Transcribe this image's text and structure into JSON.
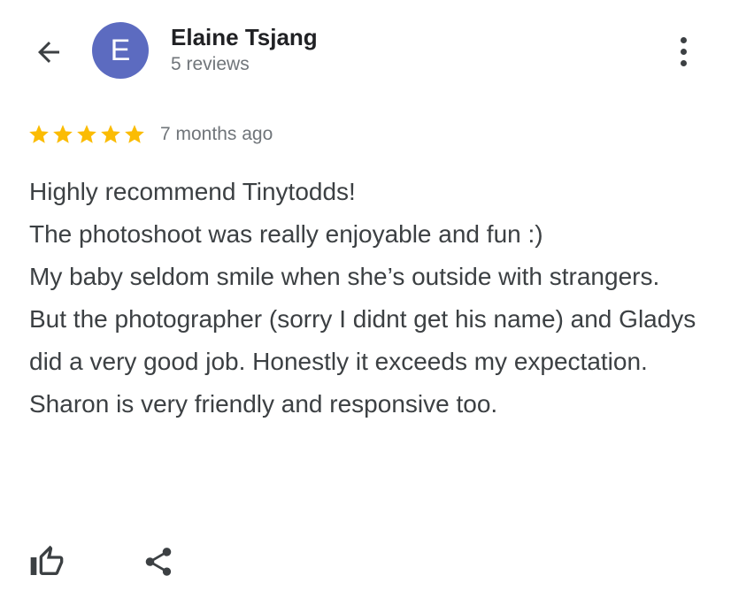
{
  "header": {
    "back_icon": "arrow-left-icon",
    "avatar_letter": "E",
    "avatar_color": "#5c6bc0",
    "author_name": "Elaine Tsjang",
    "review_count": "5 reviews",
    "more_icon": "more-vert-icon"
  },
  "review": {
    "rating": 5,
    "max_rating": 5,
    "star_color": "#fbbc04",
    "time_ago": "7 months ago",
    "lines": [
      "Highly recommend Tinytodds!",
      "The photoshoot was really enjoyable and fun :)",
      "My baby seldom smile when she’s outside with strangers.",
      "But the photographer (sorry I didnt get his name) and Gladys did a very good job. Honestly it exceeds my expectation.",
      "Sharon is very friendly and responsive too."
    ]
  },
  "actions": {
    "like_icon": "thumbs-up-icon",
    "share_icon": "share-icon"
  }
}
